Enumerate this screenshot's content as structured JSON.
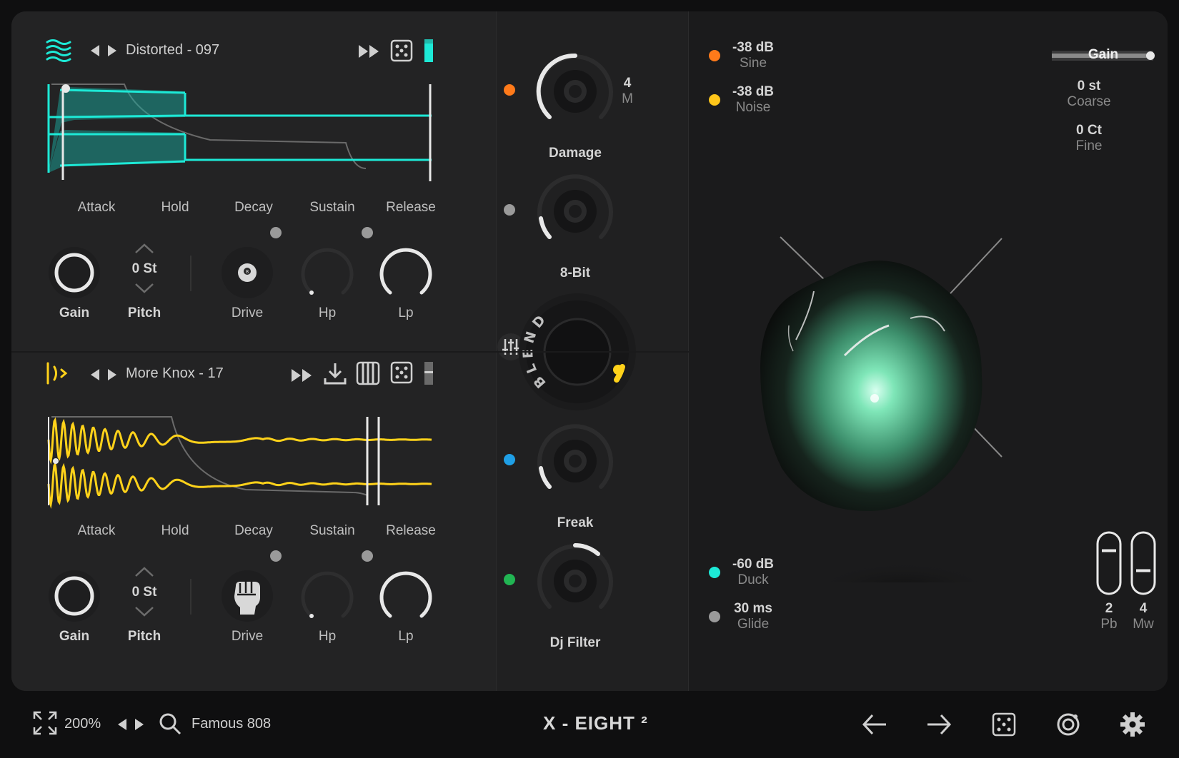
{
  "osc1": {
    "preset_name": "Distorted - 097",
    "env_labels": [
      "Attack",
      "Hold",
      "Decay",
      "Sustain",
      "Release"
    ],
    "pitch_value": "0 St",
    "knobs": {
      "gain": "Gain",
      "pitch": "Pitch",
      "drive": "Drive",
      "hp": "Hp",
      "lp": "Lp"
    },
    "accent": "#1de9d6"
  },
  "osc2": {
    "preset_name": "More Knox - 17",
    "env_labels": [
      "Attack",
      "Hold",
      "Decay",
      "Sustain",
      "Release"
    ],
    "pitch_value": "0 St",
    "knobs": {
      "gain": "Gain",
      "pitch": "Pitch",
      "drive": "Drive",
      "hp": "Hp",
      "lp": "Lp"
    },
    "accent": "#ffd21a"
  },
  "fx": {
    "damage": {
      "label": "Damage",
      "value_top": "4",
      "value_bottom": "M",
      "dot_color": "#ff7a1a"
    },
    "bit8": {
      "label": "8-Bit",
      "dot_color": "#9a9a9a"
    },
    "blend": {
      "letters": "BLEND"
    },
    "freak": {
      "label": "Freak",
      "dot_color": "#1f9fe6"
    },
    "djfilter": {
      "label": "Dj Filter",
      "dot_color": "#21b553"
    }
  },
  "right": {
    "sine": {
      "value": "-38 dB",
      "label": "Sine",
      "dot_color": "#ff7a1a"
    },
    "noise": {
      "value": "-38 dB",
      "label": "Noise",
      "dot_color": "#ffc61a"
    },
    "duck": {
      "value": "-60 dB",
      "label": "Duck",
      "dot_color": "#1de9d6"
    },
    "glide": {
      "value": "30 ms",
      "label": "Glide",
      "dot_color": "#9a9a9a"
    },
    "gain_label": "Gain",
    "coarse": {
      "value": "0 st",
      "label": "Coarse"
    },
    "fine": {
      "value": "0 Ct",
      "label": "Fine"
    },
    "pb": {
      "value": "2",
      "label": "Pb",
      "level": 0.75
    },
    "mw": {
      "value": "4",
      "label": "Mw",
      "level": 0.35
    }
  },
  "footer": {
    "zoom": "200%",
    "preset": "Famous 808",
    "app_title": "X - EIGHT ²"
  }
}
